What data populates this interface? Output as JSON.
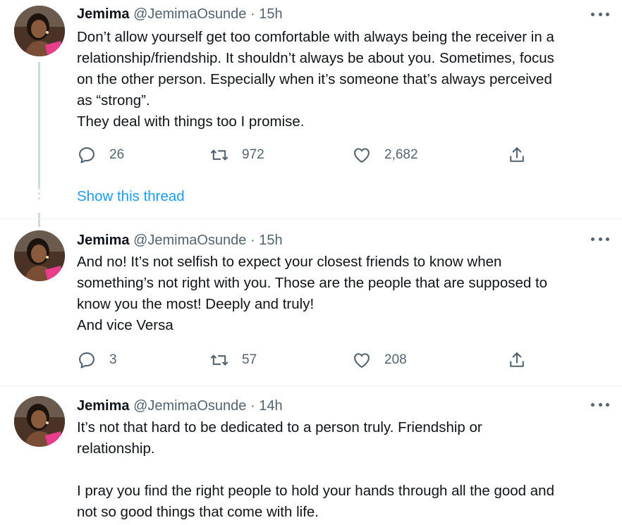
{
  "colors": {
    "text": "#0f1419",
    "secondary": "#536471",
    "link": "#1d9bf0",
    "line": "#cfd9de"
  },
  "show_thread_label": "Show this thread",
  "tweets": [
    {
      "name": "Jemima",
      "handle": "@JemimaOsunde",
      "separator": "·",
      "time": "15h",
      "lines": [
        "Don’t allow yourself get too comfortable with always being the receiver in a",
        "relationship/friendship. It shouldn’t always be about you. Sometimes, focus",
        "on the other person. Especially when it’s someone that’s always perceived",
        "as “strong”.",
        "They deal with things too I promise."
      ],
      "replies": "26",
      "retweets": "972",
      "likes": "2,682"
    },
    {
      "name": "Jemima",
      "handle": "@JemimaOsunde",
      "separator": "·",
      "time": "15h",
      "lines": [
        "And no! It’s not selfish to expect your closest friends to know when",
        "something’s not right with you. Those are the people that are supposed to",
        "know you the most! Deeply and truly!",
        "And vice Versa"
      ],
      "replies": "3",
      "retweets": "57",
      "likes": "208"
    },
    {
      "name": "Jemima",
      "handle": "@JemimaOsunde",
      "separator": "·",
      "time": "14h",
      "lines": [
        "It’s not that hard to be dedicated to a person truly. Friendship or",
        "relationship.",
        "",
        "I pray you find the right people to hold your hands through all the good and",
        "not so good things that come with life."
      ]
    }
  ],
  "icons": [
    "reply-icon",
    "retweet-icon",
    "like-icon",
    "share-icon",
    "more-icon"
  ]
}
